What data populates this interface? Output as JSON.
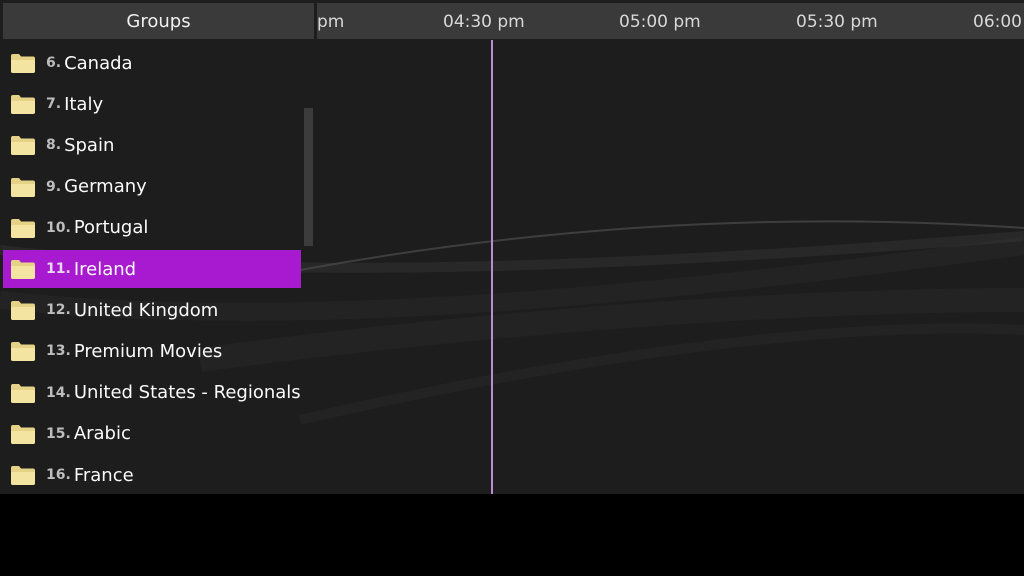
{
  "header": {
    "groups_label": "Groups",
    "times": [
      "pm",
      "04:30 pm",
      "05:00 pm",
      "05:30 pm",
      "06:00"
    ]
  },
  "groups": [
    {
      "num": "6.",
      "name": "Canada",
      "selected": false
    },
    {
      "num": "7.",
      "name": "Italy",
      "selected": false
    },
    {
      "num": "8.",
      "name": "Spain",
      "selected": false
    },
    {
      "num": "9.",
      "name": "Germany",
      "selected": false
    },
    {
      "num": "10.",
      "name": "Portugal",
      "selected": false
    },
    {
      "num": "11.",
      "name": "Ireland",
      "selected": true
    },
    {
      "num": "12.",
      "name": "United Kingdom",
      "selected": false
    },
    {
      "num": "13.",
      "name": "Premium Movies",
      "selected": false
    },
    {
      "num": "14.",
      "name": "United States - Regionals",
      "selected": false
    },
    {
      "num": "15.",
      "name": "Arabic",
      "selected": false
    },
    {
      "num": "16.",
      "name": "France",
      "selected": false
    }
  ],
  "icons": {
    "group": "folder-icon"
  },
  "colors": {
    "selected": "#a81ad0",
    "now_line": "#b98ed0",
    "folder": "#f2e19a"
  }
}
